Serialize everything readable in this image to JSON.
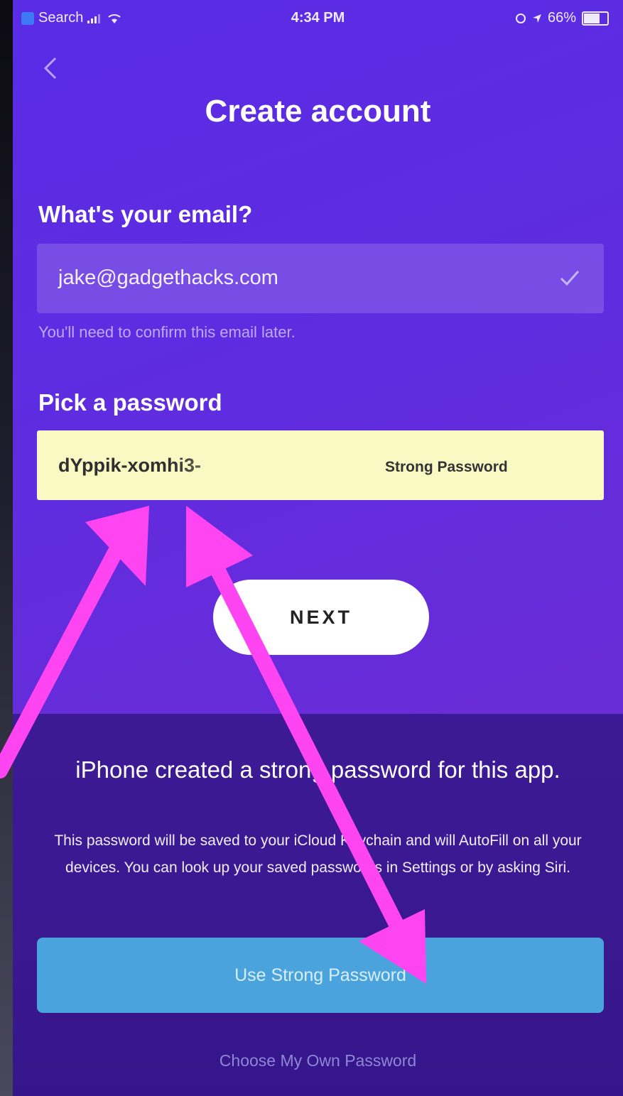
{
  "status_bar": {
    "carrier": "Search",
    "time": "4:34 PM",
    "battery": "66%",
    "battery_level": 0.66,
    "icons": [
      "signal-icon",
      "wifi-icon",
      "alarm-icon",
      "location-icon",
      "battery-icon"
    ]
  },
  "header": {
    "back_icon": "chevron-left-icon",
    "title": "Create account"
  },
  "email": {
    "label": "What's your email?",
    "value": "jake@gadgethacks.com",
    "valid_icon": "checkmark-icon",
    "hint": "You'll need to confirm this email later."
  },
  "password": {
    "label": "Pick a password",
    "value": "dYppik-xomhi3-",
    "strength": "Strong Password"
  },
  "next_button": {
    "label": "NEXT"
  },
  "sheet": {
    "title": "iPhone created a strong password for this app.",
    "body": "This password will be saved to your iCloud Keychain and will AutoFill on all your devices. You can look up your saved passwords in Settings or by asking Siri.",
    "primary_button": "Use Strong Password",
    "secondary_link": "Choose My Own Password"
  },
  "colors": {
    "background": "#5f2ce0",
    "sheet": "#3a1890",
    "primary_button": "#4aa3dc",
    "password_field": "#fbf9c3",
    "annotation_arrow": "#ff44f2"
  },
  "annotations": {
    "arrow_icon": "magenta-arrow-icon"
  }
}
